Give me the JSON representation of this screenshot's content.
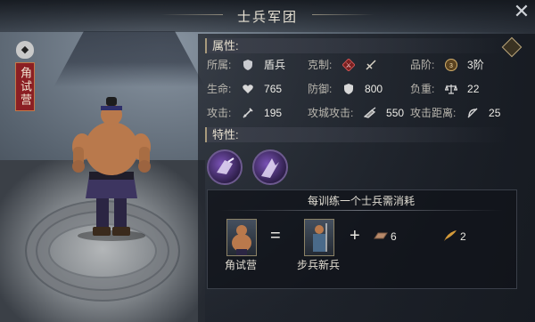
{
  "window": {
    "title": "士兵军团",
    "close_icon": "close-icon"
  },
  "unit": {
    "name": "角试营",
    "badge_icon": "shield-badge-icon"
  },
  "attributes": {
    "header": "属性:",
    "rows": [
      [
        {
          "label": "所属:",
          "icon": "shield-icon",
          "value": "盾兵"
        },
        {
          "label": "克制:",
          "icon": "spear-counter-icon",
          "value": ""
        },
        {
          "label": "品阶:",
          "icon": "rank-emblem-icon",
          "value": "3阶"
        }
      ],
      [
        {
          "label": "生命:",
          "icon": "heart-icon",
          "value": "765"
        },
        {
          "label": "防御:",
          "icon": "shield-defense-icon",
          "value": "800"
        },
        {
          "label": "负重:",
          "icon": "scale-icon",
          "value": "22"
        }
      ],
      [
        {
          "label": "攻击:",
          "icon": "sword-icon",
          "value": "195"
        },
        {
          "label": "攻城攻击:",
          "icon": "siege-icon",
          "value": "550"
        },
        {
          "label": "攻击距离:",
          "icon": "bow-icon",
          "value": "25"
        }
      ]
    ],
    "rank_badge_text": "3阶"
  },
  "traits": {
    "header": "特性:",
    "items": [
      {
        "icon": "shield-bash-trait-icon"
      },
      {
        "icon": "charge-trait-icon"
      }
    ]
  },
  "training_cost": {
    "title": "每训练一个士兵需消耗",
    "result_name": "角试营",
    "equals": "=",
    "ingredient_name": "步兵新兵",
    "plus": "+",
    "resources": [
      {
        "icon": "iron-ingot-icon",
        "amount": "6"
      },
      {
        "icon": "feather-icon",
        "amount": "2"
      }
    ]
  }
}
